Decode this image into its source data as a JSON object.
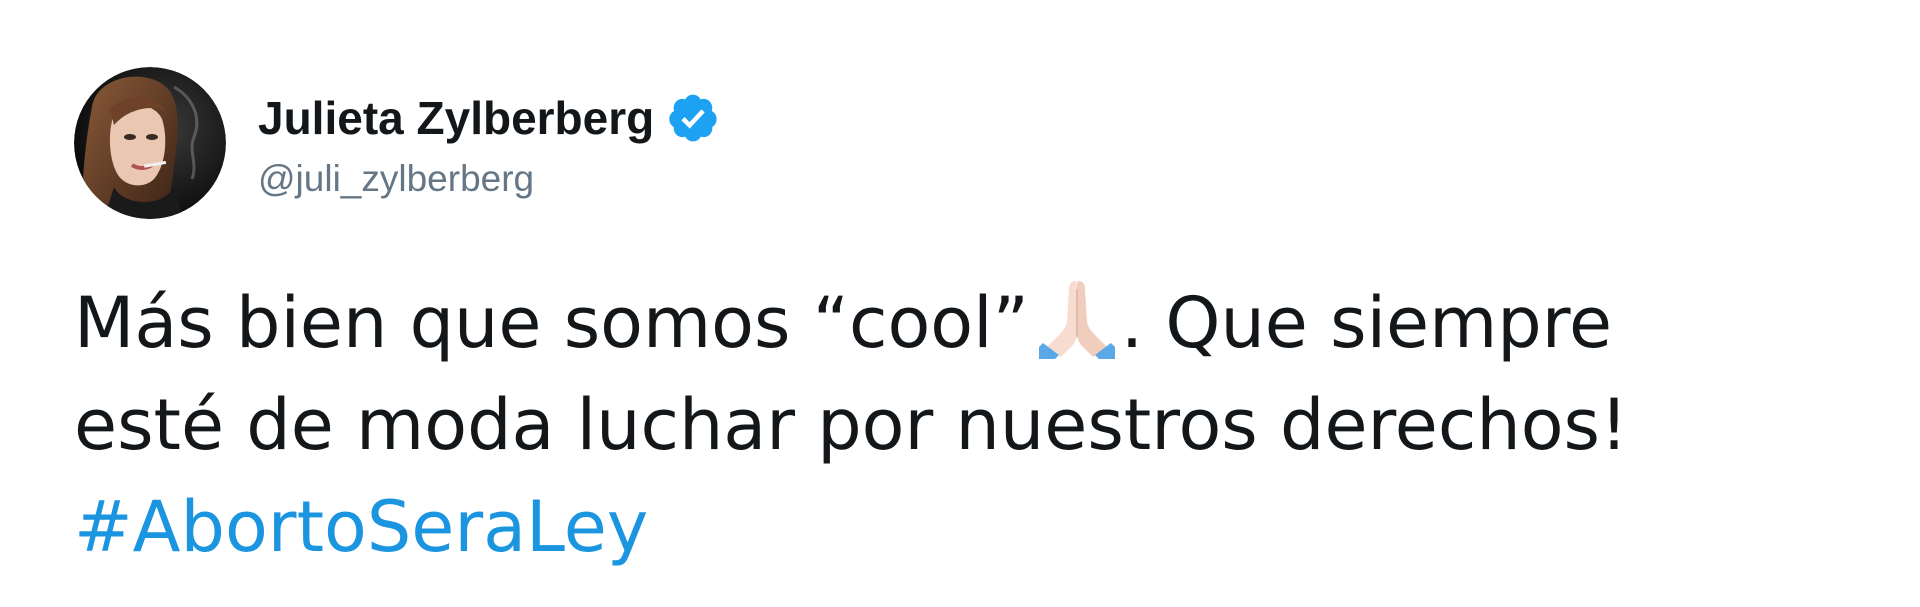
{
  "author": {
    "display_name": "Julieta Zylberberg",
    "handle": "@juli_zylberberg",
    "verified": true,
    "verified_icon": "verified-badge-icon",
    "avatar_icon": "profile-photo-avatar"
  },
  "tweet": {
    "line1_before_emoji": "Más bien que somos “cool”",
    "emoji": "folded-hands-icon",
    "line1_after_emoji": ". Que siempre",
    "line2": "esté de moda luchar por nuestros derechos!",
    "hashtag": "#AbortoSeraLey"
  },
  "colors": {
    "text": "#14171a",
    "handle": "#657786",
    "link": "#1b95e0",
    "verified": "#1da1f2"
  }
}
